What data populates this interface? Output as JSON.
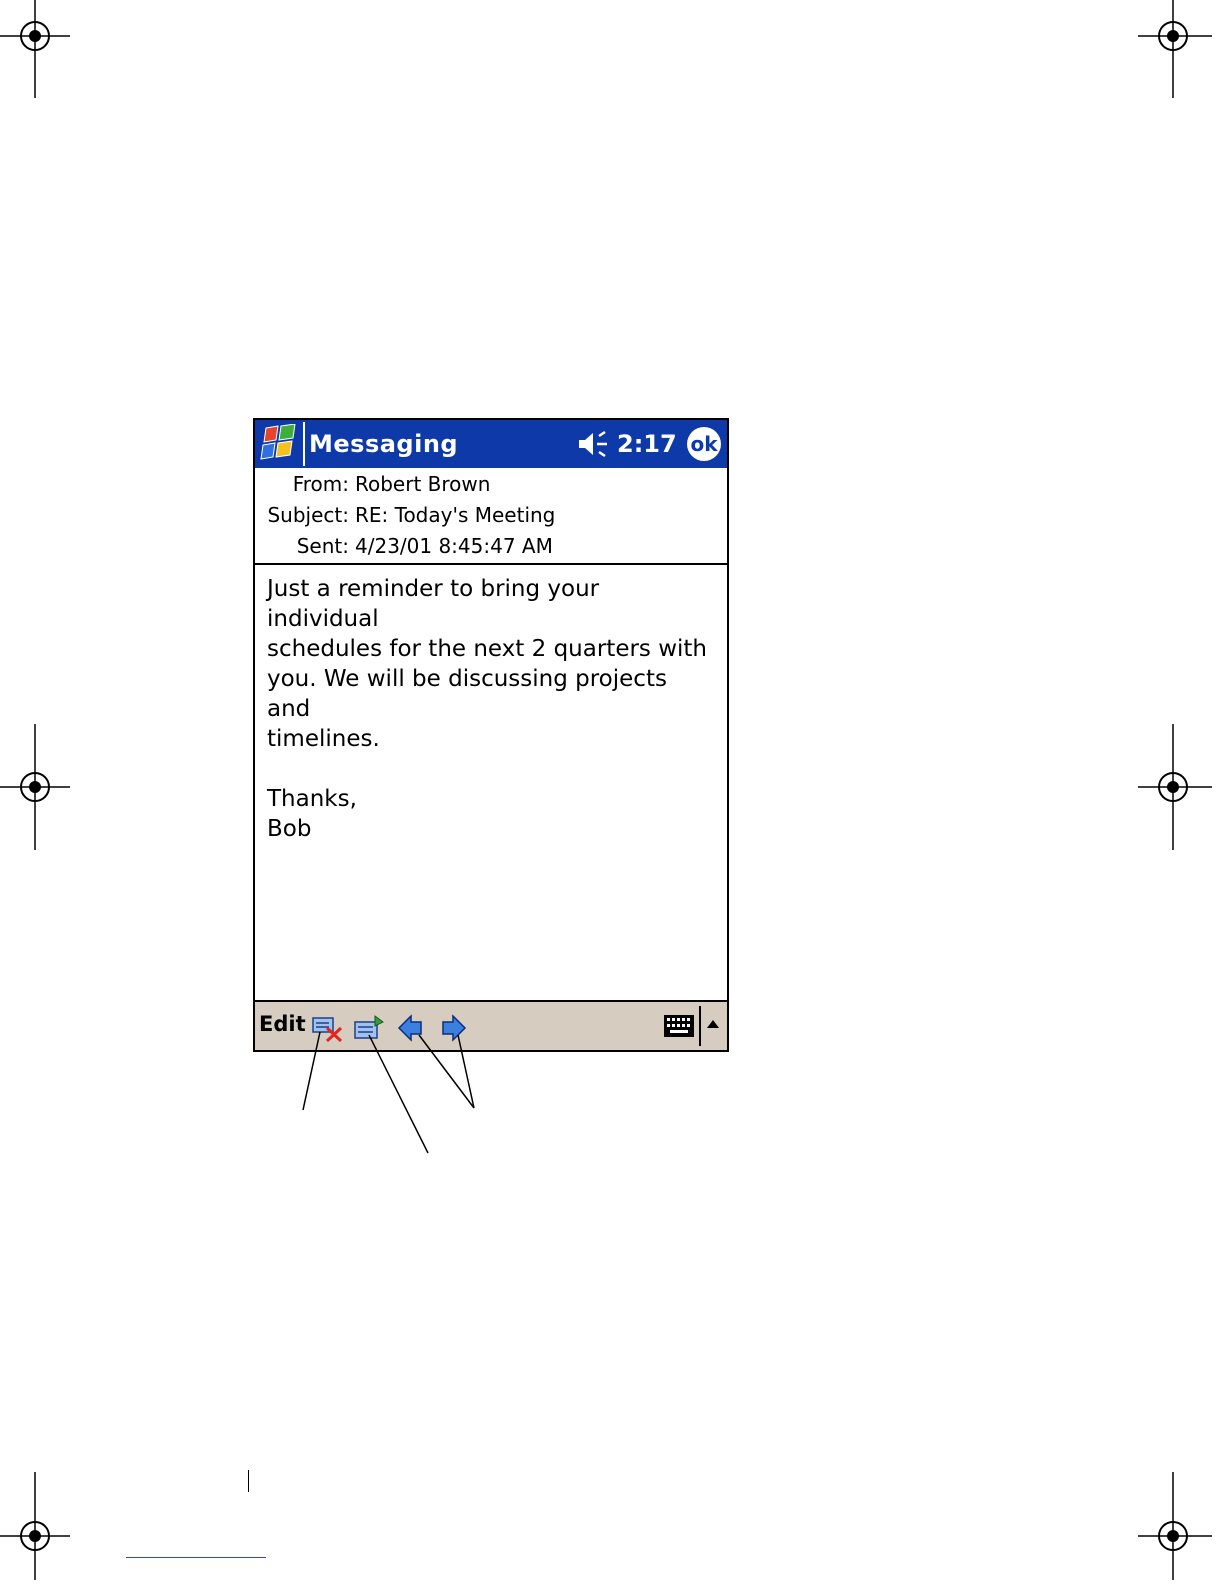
{
  "app": {
    "title": "Messaging",
    "clock": "2:17",
    "ok_label": "ok",
    "start_icon": "windows-flag-icon",
    "volume_icon": "speaker-icon"
  },
  "message": {
    "from_label": "From:",
    "from_value": "Robert Brown",
    "subject_label": "Subject:",
    "subject_value": "RE: Today's Meeting",
    "sent_label": "Sent:",
    "sent_value": "4/23/01 8:45:47 AM",
    "body_lines": [
      "Just a reminder to bring your individual",
      "schedules for the next 2 quarters with",
      "you. We will be discussing projects and",
      "timelines."
    ],
    "sign_lines": [
      "Thanks,",
      "Bob"
    ]
  },
  "menubar": {
    "edit_label": "Edit",
    "icons": [
      "delete-message-icon",
      "reply-icon",
      "previous-arrow-icon",
      "next-arrow-icon",
      "keyboard-icon",
      "sip-up-arrow-icon"
    ]
  },
  "colors": {
    "titlebar": "#0d3aa8",
    "menubar": "#d6ccc0"
  }
}
